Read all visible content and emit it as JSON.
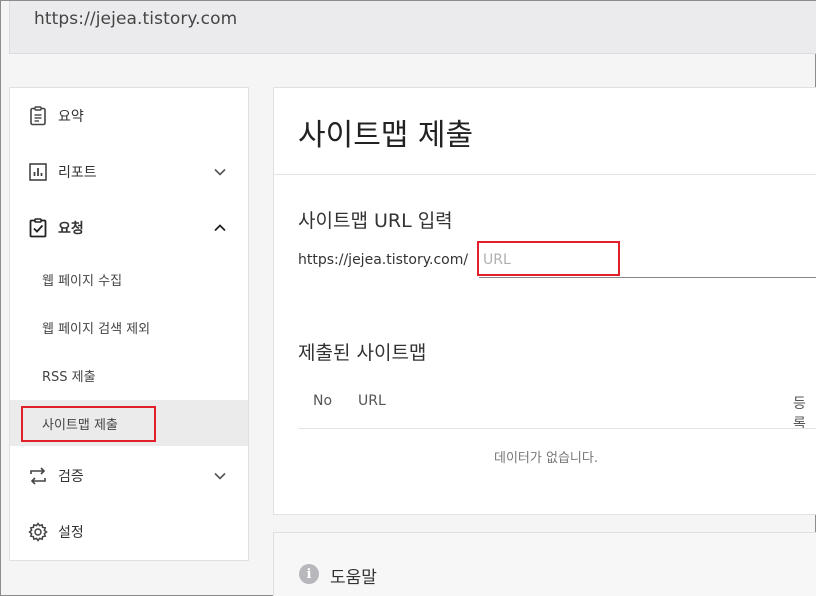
{
  "site": {
    "url": "https://jejea.tistory.com"
  },
  "sidebar": {
    "items": [
      {
        "label": "요약",
        "icon": "clipboard-icon"
      },
      {
        "label": "리포트",
        "icon": "bar-chart-icon",
        "expanded": false
      },
      {
        "label": "요청",
        "icon": "clipboard-check-icon",
        "expanded": true,
        "children": [
          {
            "label": "웹 페이지 수집"
          },
          {
            "label": "웹 페이지 검색 제외"
          },
          {
            "label": "RSS 제출"
          },
          {
            "label": "사이트맵 제출",
            "active": true
          }
        ]
      },
      {
        "label": "검증",
        "icon": "swap-arrows-icon",
        "expanded": false
      },
      {
        "label": "설정",
        "icon": "gear-icon"
      }
    ]
  },
  "main": {
    "title": "사이트맵 제출",
    "url_section": {
      "title": "사이트맵 URL 입력",
      "prefix": "https://jejea.tistory.com/",
      "input_placeholder": "URL",
      "input_value": ""
    },
    "submitted_section": {
      "title": "제출된 사이트맵",
      "columns": [
        "No",
        "URL",
        "등록"
      ],
      "empty_message": "데이터가 없습니다."
    }
  },
  "help": {
    "label": "도움말",
    "icon": "info-icon"
  },
  "colors": {
    "highlight": "#e0202a",
    "active_bg": "#ebebeb"
  }
}
